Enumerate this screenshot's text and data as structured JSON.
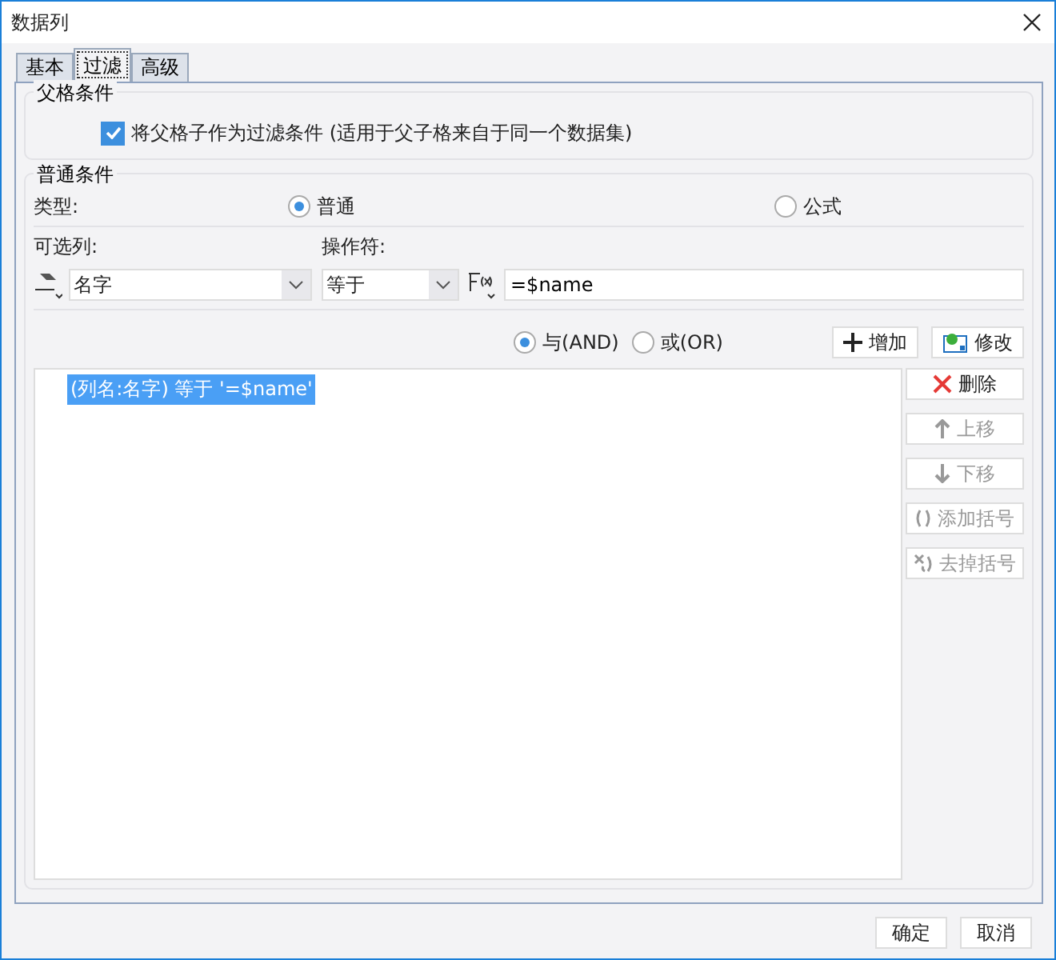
{
  "window": {
    "title": "数据列"
  },
  "tabs": [
    {
      "label": "基本",
      "selected": false
    },
    {
      "label": "过滤",
      "selected": true
    },
    {
      "label": "高级",
      "selected": false
    }
  ],
  "parent_condition": {
    "title": "父格条件",
    "checkbox": {
      "label": "将父格子作为过滤条件 (适用于父子格来自于同一个数据集)",
      "checked": true
    }
  },
  "normal_condition": {
    "title": "普通条件",
    "type_label": "类型:",
    "type_options": [
      {
        "label": "普通",
        "selected": true
      },
      {
        "label": "公式",
        "selected": false
      }
    ],
    "column_label": "可选列:",
    "operator_label": "操作符:",
    "column_select": {
      "value": "名字"
    },
    "operator_select": {
      "value": "等于"
    },
    "formula_field": {
      "value": "=$name"
    },
    "logic_options": [
      {
        "label": "与(AND)",
        "selected": true
      },
      {
        "label": "或(OR)",
        "selected": false
      }
    ],
    "add_button": "增加",
    "modify_button": "修改",
    "conditions": [
      {
        "text": "(列名:名字) 等于 '=$name'",
        "selected": true
      }
    ],
    "side_buttons": [
      {
        "kind": "delete",
        "label": "删除",
        "disabled": false
      },
      {
        "kind": "up",
        "label": "上移",
        "disabled": true
      },
      {
        "kind": "down",
        "label": "下移",
        "disabled": true
      },
      {
        "kind": "add-paren",
        "label": "添加括号",
        "disabled": true
      },
      {
        "kind": "remove-paren",
        "label": "去掉括号",
        "disabled": true
      }
    ]
  },
  "footer_buttons": [
    "确定",
    "取消"
  ]
}
